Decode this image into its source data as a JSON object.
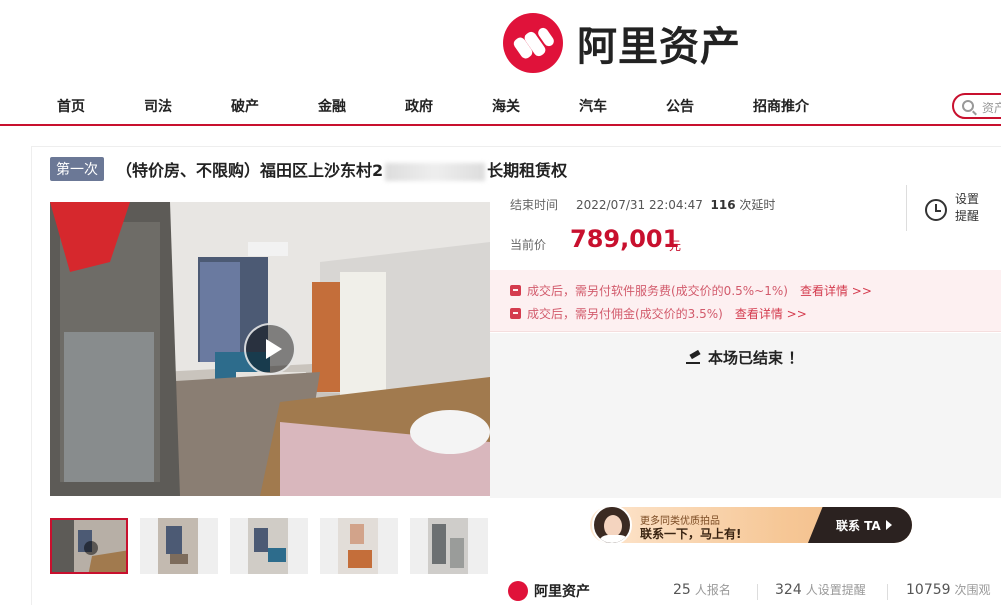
{
  "brand": {
    "name": "阿里资产",
    "color": "#e0123a"
  },
  "nav": {
    "items": [
      "首页",
      "司法",
      "破产",
      "金融",
      "政府",
      "海关",
      "汽车",
      "公告",
      "招商推介"
    ],
    "search_placeholder": "资产"
  },
  "auction": {
    "round_badge": "第一次",
    "title_prefix": "（特价房、不限购）福田区上沙东村2",
    "title_suffix": "长期租赁权",
    "end_time_label": "结束时间",
    "end_time": "2022/07/31 22:04:47",
    "delay_count": "116",
    "delay_label": "次延时",
    "reminder_label": "设置提醒",
    "price_label": "当前价",
    "price": "789,001",
    "price_unit": "元",
    "fees": [
      {
        "text": "成交后，需另付软件服务费(成交价的0.5%~1%)",
        "link": "查看详情 >>"
      },
      {
        "text": "成交后，需另付佣金(成交价的3.5%)",
        "link": "查看详情 >>"
      }
    ],
    "status": "本场已结束 ！"
  },
  "banner": {
    "line1": "更多同类优质拍品",
    "line2": "联系一下，马上有!",
    "cta": "联系 TA"
  },
  "footer": {
    "logo_text": "阿里资产",
    "stats": [
      {
        "value": "25",
        "label": "人报名"
      },
      {
        "value": "324",
        "label": "人设置提醒"
      },
      {
        "value": "10759",
        "label": "次围观"
      }
    ]
  },
  "icons": [
    "search-icon",
    "alarm-clock-icon",
    "fee-tag-icon",
    "gavel-icon",
    "play-icon",
    "chevron-right-icon"
  ],
  "colors": {
    "accent": "#c8102e",
    "badge": "#6b7896",
    "fee_text": "#d25b6c"
  }
}
